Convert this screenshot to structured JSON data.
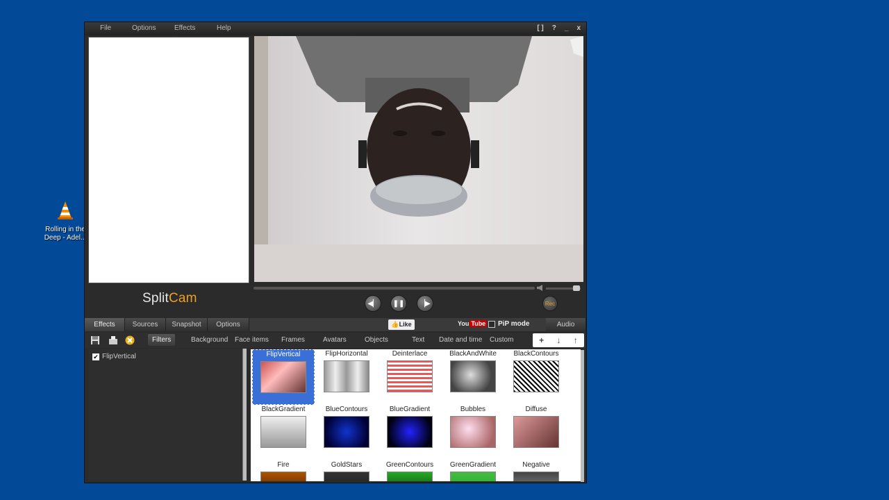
{
  "desktop": {
    "icon_label": "Rolling in the Deep - Adel...",
    "icon_name": "vlc-cone-icon"
  },
  "menu": [
    "File",
    "Options",
    "Effects",
    "Help"
  ],
  "window_controls": [
    "[ ]",
    "?",
    "_",
    "x"
  ],
  "logo": {
    "text_a": "Split",
    "text_b": "Cam"
  },
  "player": {
    "rec_label": "Rec"
  },
  "tabs": [
    "Effects",
    "Sources",
    "Snapshot",
    "Options"
  ],
  "like_label": "Like",
  "youtube_label": "You",
  "youtube_badge": "Tube",
  "pip_label": "PiP mode",
  "audio_label": "Audio",
  "subtabs": [
    "Filters",
    "Background",
    "Face items",
    "Frames",
    "Avatars",
    "Objects",
    "Text",
    "Date and time",
    "Custom"
  ],
  "action_buttons": [
    "+",
    "↓",
    "↑"
  ],
  "applied_filters": [
    {
      "label": "FlipVertical",
      "checked": true
    }
  ],
  "effects_grid": [
    "FlipVertical",
    "FlipHorizontal",
    "Deinterlace",
    "BlackAndWhite",
    "BlackContours",
    "BlackGradient",
    "BlueContours",
    "BlueGradient",
    "Bubbles",
    "Diffuse",
    "Fire",
    "GoldStars",
    "GreenContours",
    "GreenGradient",
    "Negative"
  ],
  "selected_effect": "FlipVertical",
  "colors": {
    "desktop": "#024a98",
    "window": "#2b2b2b",
    "selection": "#3a6fd8",
    "rec": "#e8a020"
  }
}
